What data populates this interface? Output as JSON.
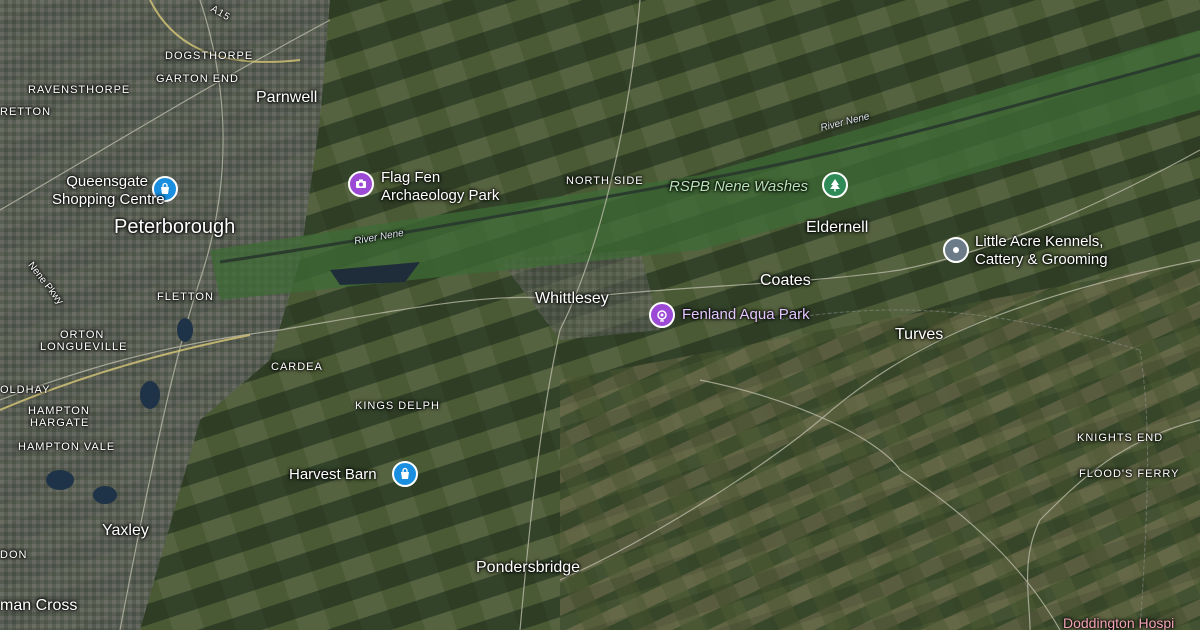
{
  "map": {
    "places": {
      "peterborough": "Peterborough",
      "parnwell": "Parnwell",
      "dogsthorpe": "DOGSTHORPE",
      "garton_end": "GARTON END",
      "ravensthorpe": "RAVENSTHORPE",
      "retton": "RETTON",
      "fletton": "FLETTON",
      "orton": "ORTON",
      "longueville": "LONGUEVILLE",
      "oldhay": "OLDHAY",
      "hampton": "HAMPTON",
      "hargate": "HARGATE",
      "hampton_vale": "HAMPTON VALE",
      "don": "DON",
      "yaxley": "Yaxley",
      "man_cross": "man Cross",
      "cardea": "CARDEA",
      "kings_delph": "KINGS DELPH",
      "north_side": "NORTH SIDE",
      "whittlesey": "Whittlesey",
      "eldernell": "Eldernell",
      "coates": "Coates",
      "turves": "Turves",
      "pondersbridge": "Pondersbridge",
      "knights_end": "KNIGHTS END",
      "floods_ferry": "FLOOD'S FERRY",
      "doddington": "Doddington Hospi"
    },
    "roads": {
      "a15": "A15",
      "nene_pkwy": "Nene Pkwy"
    },
    "water": {
      "river_nene_1": "River Nene",
      "river_nene_2": "River Nene"
    },
    "pois": {
      "queensgate_line1": "Queensgate",
      "queensgate_line2": "Shopping Centre",
      "flagfen_line1": "Flag Fen",
      "flagfen_line2": "Archaeology Park",
      "rspb": "RSPB Nene Washes",
      "littleacre_line1": "Little Acre Kennels,",
      "littleacre_line2": "Cattery & Grooming",
      "fenland": "Fenland Aqua Park",
      "harvest_barn": "Harvest Barn"
    },
    "icons": {
      "shopping": "shopping-bag-icon",
      "museum": "camera-icon",
      "park": "tree-icon",
      "pin": "location-pin-icon",
      "attraction": "attraction-icon"
    },
    "colors": {
      "shopping_pin": "#1a8fe0",
      "attraction_pin": "#9c49d6",
      "park_pin": "#2e8b57",
      "generic_pin": "#6b7b88"
    }
  }
}
